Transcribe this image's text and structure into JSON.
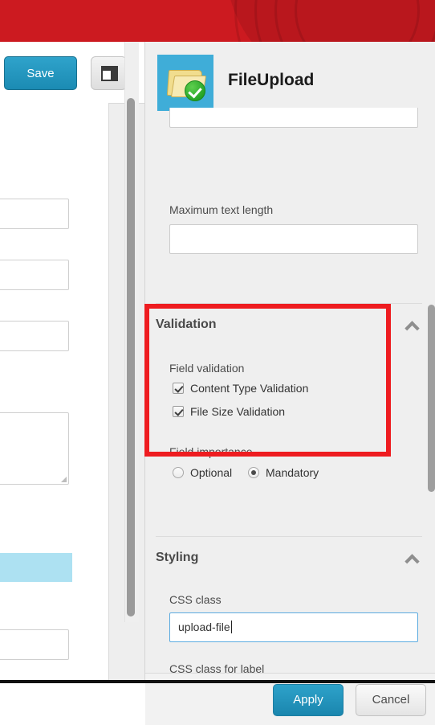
{
  "banner": {
    "name": "app-banner",
    "color": "#cc1a20"
  },
  "left_toolbar": {
    "save_label": "Save",
    "panel_toggle_icon": "layout-panel-icon"
  },
  "properties_panel": {
    "icon": "file-upload-folder-check-icon",
    "icon_background": "#3fadd8",
    "title": "FileUpload",
    "top_field": {
      "label": "",
      "value": ""
    },
    "max_text_length": {
      "label": "Maximum text length",
      "value": "",
      "placeholder": ""
    },
    "validation_section": {
      "title": "Validation",
      "collapse_icon": "chevron-up-icon",
      "field_validation_label": "Field validation",
      "checkboxes": [
        {
          "label": "Content Type Validation",
          "checked": true
        },
        {
          "label": "File Size Validation",
          "checked": true
        }
      ],
      "field_importance_label": "Field importance",
      "radios": [
        {
          "label": "Optional",
          "selected": false
        },
        {
          "label": "Mandatory",
          "selected": true
        }
      ]
    },
    "styling_section": {
      "title": "Styling",
      "collapse_icon": "chevron-up-icon",
      "css_class": {
        "label": "CSS class",
        "value": "upload-file",
        "focused": true
      },
      "css_class_for_label": {
        "label": "CSS class for label"
      }
    },
    "footer": {
      "apply_label": "Apply",
      "cancel_label": "Cancel"
    }
  },
  "highlight": {
    "name": "validation-highlight-box",
    "color": "#ee1c20"
  }
}
